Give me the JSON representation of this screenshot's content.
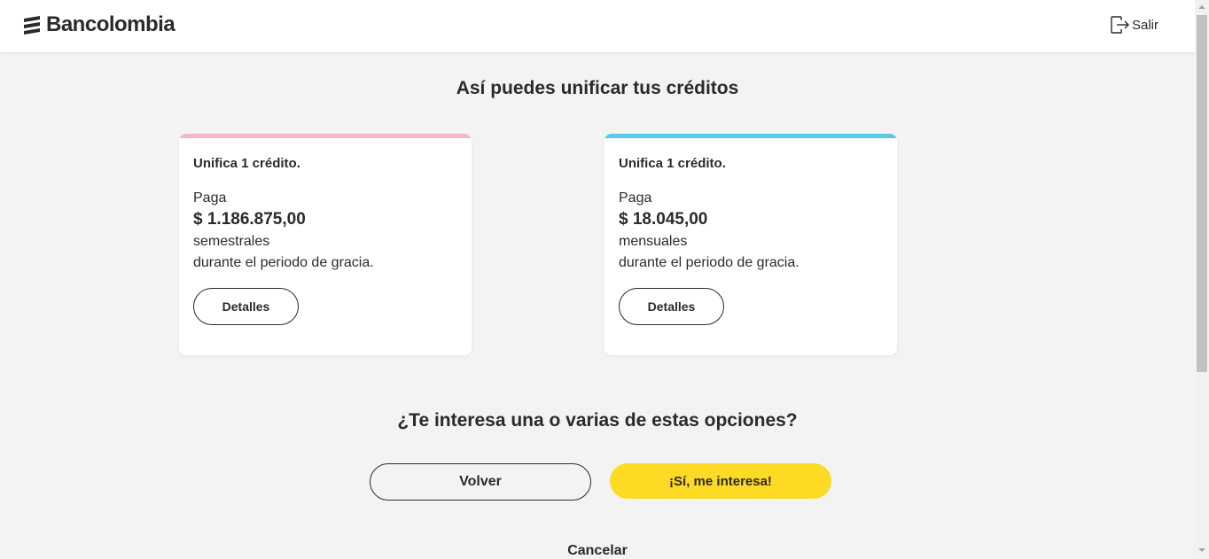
{
  "header": {
    "brand": "Bancolombia",
    "logout_label": "Salir"
  },
  "main": {
    "title": "Así puedes unificar tus créditos",
    "cards": [
      {
        "heading": "Unifica 1 crédito.",
        "pay_label": "Paga",
        "amount": "$ 1.186.875,00",
        "period": "semestrales",
        "grace": "durante el periodo de gracia.",
        "details_label": "Detalles",
        "accent_color": "#f5b6cd"
      },
      {
        "heading": "Unifica 1 crédito.",
        "pay_label": "Paga",
        "amount": "$ 18.045,00",
        "period": "mensuales",
        "grace": "durante el periodo de gracia.",
        "details_label": "Detalles",
        "accent_color": "#59cbe8"
      }
    ],
    "question": "¿Te interesa una o varias de estas opciones?",
    "back_label": "Volver",
    "confirm_label": "¡Sí, me interesa!",
    "cancel_label": "Cancelar"
  },
  "colors": {
    "brand_yellow": "#fdda24",
    "text": "#2c2a29",
    "background": "#f3f3f3"
  }
}
